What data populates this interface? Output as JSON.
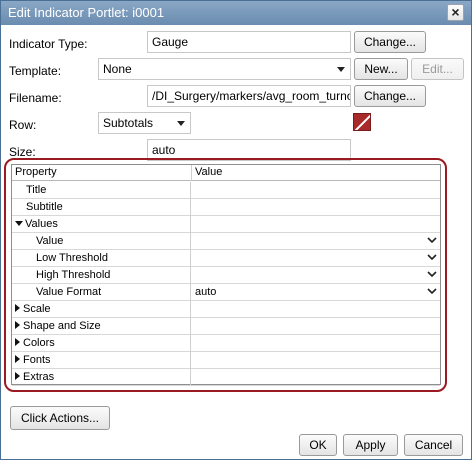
{
  "window": {
    "title": "Edit Indicator Portlet: i0001",
    "close_glyph": "×"
  },
  "form": {
    "indicator_type_label": "Indicator Type:",
    "indicator_type_value": "Gauge",
    "indicator_change_label": "Change...",
    "template_label": "Template:",
    "template_value": "None",
    "template_new_label": "New...",
    "template_edit_label": "Edit...",
    "filename_label": "Filename:",
    "filename_value": "/DI_Surgery/markers/avg_room_turnover",
    "filename_change_label": "Change...",
    "row_label": "Row:",
    "row_value": "Subtotals",
    "size_label": "Size:",
    "size_value": "auto",
    "swatch_color": "#a82a2a"
  },
  "properties": {
    "header_property": "Property",
    "header_value": "Value",
    "rows": [
      {
        "label": "Title",
        "value": "",
        "kind": "leaf",
        "indent": 1,
        "dropdown": false
      },
      {
        "label": "Subtitle",
        "value": "",
        "kind": "leaf",
        "indent": 1,
        "dropdown": false
      },
      {
        "label": "Values",
        "value": "",
        "kind": "expanded",
        "indent": 0,
        "dropdown": false
      },
      {
        "label": "Value",
        "value": "",
        "kind": "leaf",
        "indent": 2,
        "dropdown": true
      },
      {
        "label": "Low Threshold",
        "value": "",
        "kind": "leaf",
        "indent": 2,
        "dropdown": true
      },
      {
        "label": "High Threshold",
        "value": "",
        "kind": "leaf",
        "indent": 2,
        "dropdown": true
      },
      {
        "label": "Value Format",
        "value": "auto",
        "kind": "leaf",
        "indent": 2,
        "dropdown": true
      },
      {
        "label": "Scale",
        "value": "",
        "kind": "collapsed",
        "indent": 0,
        "dropdown": false
      },
      {
        "label": "Shape and Size",
        "value": "",
        "kind": "collapsed",
        "indent": 0,
        "dropdown": false
      },
      {
        "label": "Colors",
        "value": "",
        "kind": "collapsed",
        "indent": 0,
        "dropdown": false
      },
      {
        "label": "Fonts",
        "value": "",
        "kind": "collapsed",
        "indent": 0,
        "dropdown": false
      },
      {
        "label": "Extras",
        "value": "",
        "kind": "collapsed",
        "indent": 0,
        "dropdown": false
      }
    ]
  },
  "footer": {
    "click_actions_label": "Click Actions...",
    "ok_label": "OK",
    "apply_label": "Apply",
    "cancel_label": "Cancel"
  },
  "colors": {
    "frame_accent": "#9b1a22",
    "titlebar": "#7796b8"
  }
}
